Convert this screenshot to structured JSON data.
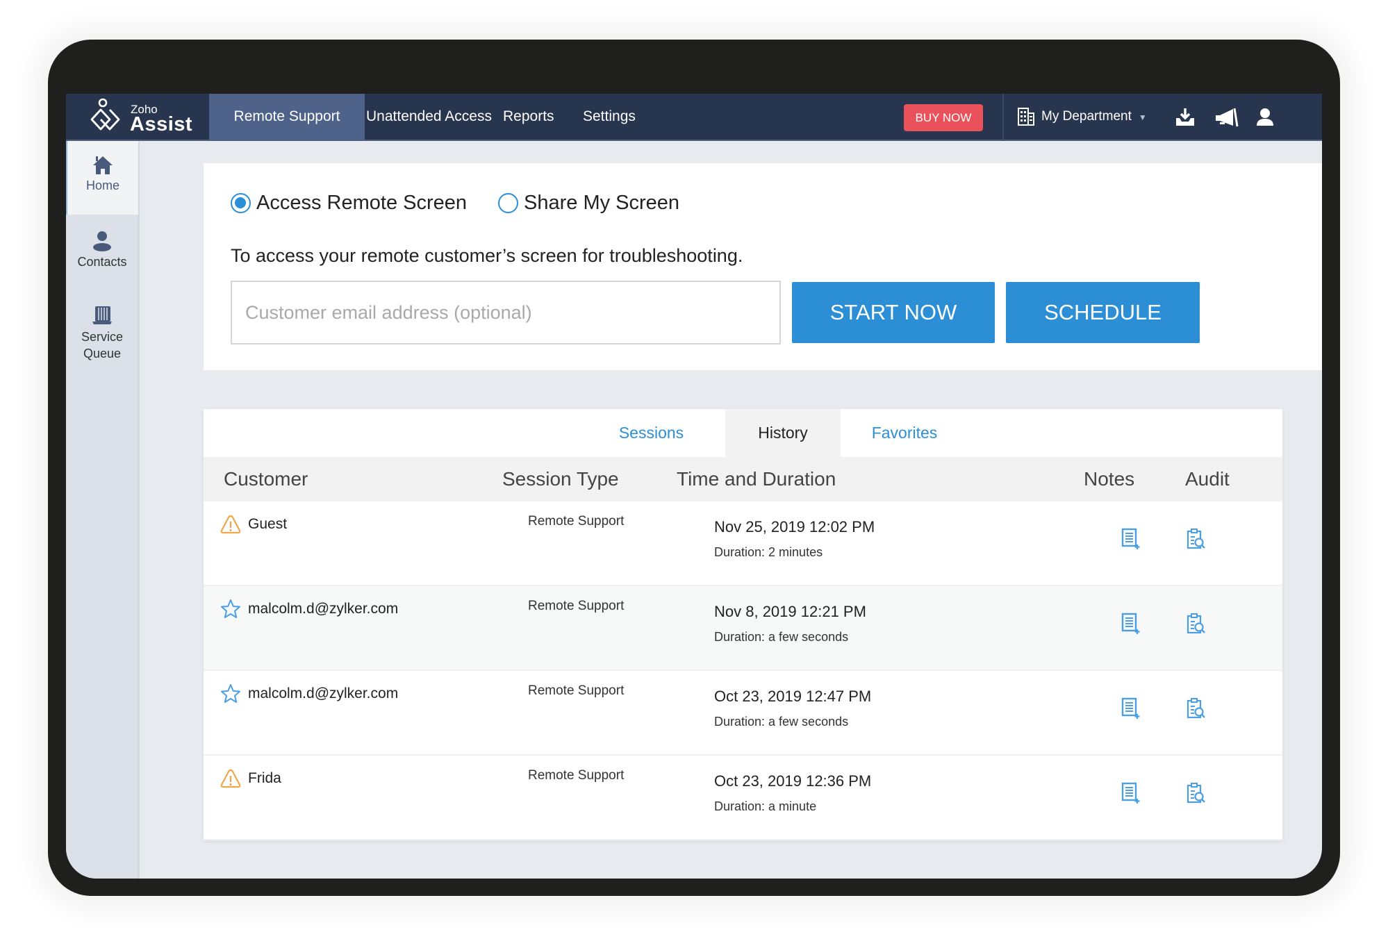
{
  "app": {
    "brand_small": "Zoho",
    "brand_large": "Assist"
  },
  "nav": {
    "items": [
      {
        "label": "Remote Support",
        "active": true
      },
      {
        "label": "Unattended Access",
        "active": false
      },
      {
        "label": "Reports",
        "active": false
      },
      {
        "label": "Settings",
        "active": false
      }
    ],
    "buy_now": "BUY NOW",
    "department": "My Department",
    "icons": [
      "download-icon",
      "announcement-icon",
      "user-profile-icon"
    ]
  },
  "sidebar": {
    "items": [
      {
        "label": "Home",
        "icon": "home-icon",
        "active": true
      },
      {
        "label": "Contacts",
        "icon": "contact-icon",
        "active": false
      },
      {
        "label": "Service Queue",
        "label_line1": "Service",
        "label_line2": "Queue",
        "icon": "service-queue-icon",
        "active": false
      }
    ]
  },
  "session_start": {
    "options": [
      {
        "label": "Access Remote Screen",
        "selected": true
      },
      {
        "label": "Share My Screen",
        "selected": false
      }
    ],
    "description": "To access your remote customer’s screen for troubleshooting.",
    "email_placeholder": "Customer email address (optional)",
    "email_value": "",
    "start_now": "START NOW",
    "schedule": "SCHEDULE"
  },
  "history": {
    "tabs": [
      {
        "label": "Sessions",
        "active": false
      },
      {
        "label": "History",
        "active": true
      },
      {
        "label": "Favorites",
        "active": false
      }
    ],
    "columns": [
      "Customer",
      "Session Type",
      "Time and Duration",
      "Notes",
      "Audit"
    ],
    "rows": [
      {
        "customer": "Guest",
        "icon": "warning-icon",
        "session_type": "Remote Support",
        "time": "Nov 25, 2019 12:02 PM",
        "duration": "Duration: 2 minutes"
      },
      {
        "customer": "malcolm.d@zylker.com",
        "icon": "star-icon",
        "session_type": "Remote Support",
        "time": "Nov 8, 2019 12:21 PM",
        "duration": "Duration: a few seconds"
      },
      {
        "customer": "malcolm.d@zylker.com",
        "icon": "star-icon",
        "session_type": "Remote Support",
        "time": "Oct 23, 2019 12:47 PM",
        "duration": "Duration: a few seconds"
      },
      {
        "customer": "Frida",
        "icon": "warning-icon",
        "session_type": "Remote Support",
        "time": "Oct 23, 2019 12:36 PM",
        "duration": "Duration: a minute"
      }
    ]
  },
  "colors": {
    "navbar": "#28354f",
    "nav_active": "#4f6289",
    "accent": "#2c8fd6",
    "buy_now": "#e9525a",
    "warning": "#f0a64a"
  }
}
